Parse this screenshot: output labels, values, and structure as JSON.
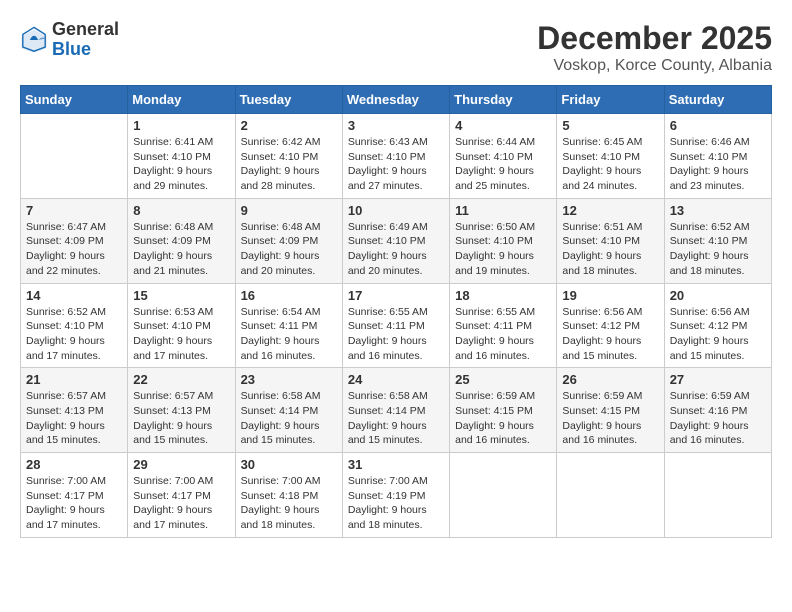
{
  "logo": {
    "general": "General",
    "blue": "Blue"
  },
  "header": {
    "month": "December 2025",
    "location": "Voskop, Korce County, Albania"
  },
  "weekdays": [
    "Sunday",
    "Monday",
    "Tuesday",
    "Wednesday",
    "Thursday",
    "Friday",
    "Saturday"
  ],
  "weeks": [
    [
      {
        "day": "",
        "sunrise": "",
        "sunset": "",
        "daylight": ""
      },
      {
        "day": "1",
        "sunrise": "Sunrise: 6:41 AM",
        "sunset": "Sunset: 4:10 PM",
        "daylight": "Daylight: 9 hours and 29 minutes."
      },
      {
        "day": "2",
        "sunrise": "Sunrise: 6:42 AM",
        "sunset": "Sunset: 4:10 PM",
        "daylight": "Daylight: 9 hours and 28 minutes."
      },
      {
        "day": "3",
        "sunrise": "Sunrise: 6:43 AM",
        "sunset": "Sunset: 4:10 PM",
        "daylight": "Daylight: 9 hours and 27 minutes."
      },
      {
        "day": "4",
        "sunrise": "Sunrise: 6:44 AM",
        "sunset": "Sunset: 4:10 PM",
        "daylight": "Daylight: 9 hours and 25 minutes."
      },
      {
        "day": "5",
        "sunrise": "Sunrise: 6:45 AM",
        "sunset": "Sunset: 4:10 PM",
        "daylight": "Daylight: 9 hours and 24 minutes."
      },
      {
        "day": "6",
        "sunrise": "Sunrise: 6:46 AM",
        "sunset": "Sunset: 4:10 PM",
        "daylight": "Daylight: 9 hours and 23 minutes."
      }
    ],
    [
      {
        "day": "7",
        "sunrise": "Sunrise: 6:47 AM",
        "sunset": "Sunset: 4:09 PM",
        "daylight": "Daylight: 9 hours and 22 minutes."
      },
      {
        "day": "8",
        "sunrise": "Sunrise: 6:48 AM",
        "sunset": "Sunset: 4:09 PM",
        "daylight": "Daylight: 9 hours and 21 minutes."
      },
      {
        "day": "9",
        "sunrise": "Sunrise: 6:48 AM",
        "sunset": "Sunset: 4:09 PM",
        "daylight": "Daylight: 9 hours and 20 minutes."
      },
      {
        "day": "10",
        "sunrise": "Sunrise: 6:49 AM",
        "sunset": "Sunset: 4:10 PM",
        "daylight": "Daylight: 9 hours and 20 minutes."
      },
      {
        "day": "11",
        "sunrise": "Sunrise: 6:50 AM",
        "sunset": "Sunset: 4:10 PM",
        "daylight": "Daylight: 9 hours and 19 minutes."
      },
      {
        "day": "12",
        "sunrise": "Sunrise: 6:51 AM",
        "sunset": "Sunset: 4:10 PM",
        "daylight": "Daylight: 9 hours and 18 minutes."
      },
      {
        "day": "13",
        "sunrise": "Sunrise: 6:52 AM",
        "sunset": "Sunset: 4:10 PM",
        "daylight": "Daylight: 9 hours and 18 minutes."
      }
    ],
    [
      {
        "day": "14",
        "sunrise": "Sunrise: 6:52 AM",
        "sunset": "Sunset: 4:10 PM",
        "daylight": "Daylight: 9 hours and 17 minutes."
      },
      {
        "day": "15",
        "sunrise": "Sunrise: 6:53 AM",
        "sunset": "Sunset: 4:10 PM",
        "daylight": "Daylight: 9 hours and 17 minutes."
      },
      {
        "day": "16",
        "sunrise": "Sunrise: 6:54 AM",
        "sunset": "Sunset: 4:11 PM",
        "daylight": "Daylight: 9 hours and 16 minutes."
      },
      {
        "day": "17",
        "sunrise": "Sunrise: 6:55 AM",
        "sunset": "Sunset: 4:11 PM",
        "daylight": "Daylight: 9 hours and 16 minutes."
      },
      {
        "day": "18",
        "sunrise": "Sunrise: 6:55 AM",
        "sunset": "Sunset: 4:11 PM",
        "daylight": "Daylight: 9 hours and 16 minutes."
      },
      {
        "day": "19",
        "sunrise": "Sunrise: 6:56 AM",
        "sunset": "Sunset: 4:12 PM",
        "daylight": "Daylight: 9 hours and 15 minutes."
      },
      {
        "day": "20",
        "sunrise": "Sunrise: 6:56 AM",
        "sunset": "Sunset: 4:12 PM",
        "daylight": "Daylight: 9 hours and 15 minutes."
      }
    ],
    [
      {
        "day": "21",
        "sunrise": "Sunrise: 6:57 AM",
        "sunset": "Sunset: 4:13 PM",
        "daylight": "Daylight: 9 hours and 15 minutes."
      },
      {
        "day": "22",
        "sunrise": "Sunrise: 6:57 AM",
        "sunset": "Sunset: 4:13 PM",
        "daylight": "Daylight: 9 hours and 15 minutes."
      },
      {
        "day": "23",
        "sunrise": "Sunrise: 6:58 AM",
        "sunset": "Sunset: 4:14 PM",
        "daylight": "Daylight: 9 hours and 15 minutes."
      },
      {
        "day": "24",
        "sunrise": "Sunrise: 6:58 AM",
        "sunset": "Sunset: 4:14 PM",
        "daylight": "Daylight: 9 hours and 15 minutes."
      },
      {
        "day": "25",
        "sunrise": "Sunrise: 6:59 AM",
        "sunset": "Sunset: 4:15 PM",
        "daylight": "Daylight: 9 hours and 16 minutes."
      },
      {
        "day": "26",
        "sunrise": "Sunrise: 6:59 AM",
        "sunset": "Sunset: 4:15 PM",
        "daylight": "Daylight: 9 hours and 16 minutes."
      },
      {
        "day": "27",
        "sunrise": "Sunrise: 6:59 AM",
        "sunset": "Sunset: 4:16 PM",
        "daylight": "Daylight: 9 hours and 16 minutes."
      }
    ],
    [
      {
        "day": "28",
        "sunrise": "Sunrise: 7:00 AM",
        "sunset": "Sunset: 4:17 PM",
        "daylight": "Daylight: 9 hours and 17 minutes."
      },
      {
        "day": "29",
        "sunrise": "Sunrise: 7:00 AM",
        "sunset": "Sunset: 4:17 PM",
        "daylight": "Daylight: 9 hours and 17 minutes."
      },
      {
        "day": "30",
        "sunrise": "Sunrise: 7:00 AM",
        "sunset": "Sunset: 4:18 PM",
        "daylight": "Daylight: 9 hours and 18 minutes."
      },
      {
        "day": "31",
        "sunrise": "Sunrise: 7:00 AM",
        "sunset": "Sunset: 4:19 PM",
        "daylight": "Daylight: 9 hours and 18 minutes."
      },
      {
        "day": "",
        "sunrise": "",
        "sunset": "",
        "daylight": ""
      },
      {
        "day": "",
        "sunrise": "",
        "sunset": "",
        "daylight": ""
      },
      {
        "day": "",
        "sunrise": "",
        "sunset": "",
        "daylight": ""
      }
    ]
  ]
}
